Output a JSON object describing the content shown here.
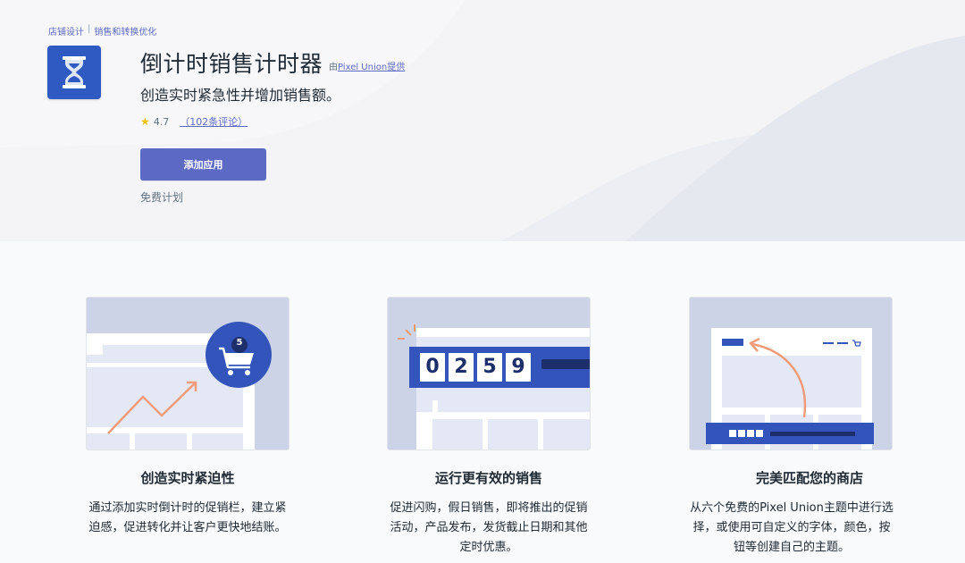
{
  "breadcrumb": {
    "items": [
      "店铺设计",
      "销售和转换优化"
    ],
    "separator": "|"
  },
  "app": {
    "icon": "hourglass-icon",
    "title": "倒计时销售计时器",
    "by_prefix": "由",
    "developer": "Pixel Union",
    "by_suffix": "提供",
    "tagline": "创造实时紧急性并增加销售额。",
    "rating_value": "4.7",
    "reviews_text": "（102条评论）",
    "add_button": "添加应用",
    "plan": "免费计划"
  },
  "features": [
    {
      "title": "创造实时紧迫性",
      "desc": "通过添加实时倒计时的促销栏，建立紧迫感，促进转化并让客户更快地结账。",
      "illustration": "cart-growth-illustration",
      "badge_number": "5"
    },
    {
      "title": "运行更有效的销售",
      "desc": "促进闪购，假日销售，即将推出的促销活动，产品发布，发货截止日期和其他定时优惠。",
      "illustration": "countdown-timer-illustration",
      "digits": [
        "0",
        "2",
        "5",
        "9"
      ]
    },
    {
      "title": "完美匹配您的商店",
      "desc": "从六个免费的Pixel Union主题中进行选择，或使用可自定义的字体，颜色，按钮等创建自己的主题。",
      "illustration": "store-theme-illustration"
    }
  ],
  "colors": {
    "accent": "#5c6ac4",
    "icon_bg": "#2f5ac1",
    "illustration_blue": "#3355bb",
    "illustration_bg": "#ccd3e6",
    "arrow": "#f09c7a",
    "star": "#eec200"
  }
}
